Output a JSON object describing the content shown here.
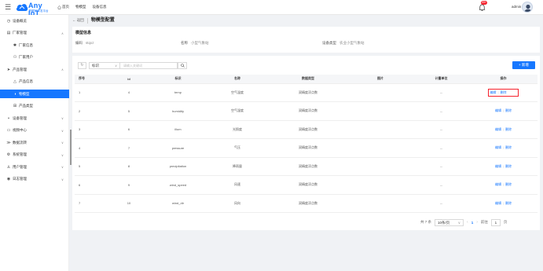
{
  "topbar": {
    "brand": "Any IoT",
    "brand_sub": "物联网开发平台",
    "nav": [
      "首页",
      "物模型",
      "设备信息"
    ],
    "badge": "99+",
    "user": "admin"
  },
  "sidebar": {
    "items": [
      {
        "icon": "dashboard-icon",
        "glyph": "◷",
        "label": "设备概览",
        "arrow": ""
      },
      {
        "icon": "factory-icon",
        "glyph": "▤",
        "label": "厂家管理",
        "arrow": "∧"
      },
      {
        "icon": "gear-icon",
        "glyph": "✱",
        "label": "厂家信息",
        "arrow": "",
        "sub": true
      },
      {
        "icon": "user-icon",
        "glyph": "⚇",
        "label": "厂家用户",
        "arrow": "",
        "sub": true
      },
      {
        "icon": "send-icon",
        "glyph": "➤",
        "label": "产品管理",
        "arrow": "∧"
      },
      {
        "icon": "triangle-icon",
        "glyph": "△",
        "label": "产品信息",
        "arrow": "",
        "sub": true
      },
      {
        "icon": "model-icon",
        "glyph": "◑",
        "label": "物模型",
        "arrow": "",
        "sub": true,
        "active": true
      },
      {
        "icon": "product-type-icon",
        "glyph": "⊞",
        "label": "产品类型",
        "arrow": "",
        "sub": true
      },
      {
        "icon": "device-icon",
        "glyph": "⑂",
        "label": "设备管理",
        "arrow": "∨"
      },
      {
        "icon": "video-icon",
        "glyph": "▭",
        "label": "视频中心",
        "arrow": "∨"
      },
      {
        "icon": "data-icon",
        "glyph": "≫",
        "label": "数据流转",
        "arrow": "∨"
      },
      {
        "icon": "settings-icon",
        "glyph": "⚙",
        "label": "系统管理",
        "arrow": "∨"
      },
      {
        "icon": "users-icon",
        "glyph": "♙",
        "label": "用户管理",
        "arrow": "∨"
      },
      {
        "icon": "log-icon",
        "glyph": "◉",
        "label": "日志管理",
        "arrow": "∨"
      }
    ]
  },
  "breadcrumb": {
    "back": "← 返回",
    "title": "物模型配置"
  },
  "info": {
    "heading": "模型信息",
    "code_label": "编码",
    "code_value": "stqxz",
    "name_label": "名称",
    "name_value": "小型气象站",
    "type_label": "设备类型",
    "type_value": "农业小型气象站"
  },
  "toolbar": {
    "select_value": "标识",
    "search_placeholder": "请输入关键词",
    "add_label": "+ 新增"
  },
  "table": {
    "headers": [
      "序号",
      "id",
      "标识",
      "名称",
      "数据类型",
      "图片",
      "计量单位",
      "操作"
    ],
    "rows": [
      {
        "idx": "1",
        "id": "4",
        "ident": "temp",
        "name": "空气温度",
        "dtype": "双精度浮点数",
        "img": "",
        "unit": "--"
      },
      {
        "idx": "2",
        "id": "5",
        "ident": "humidity",
        "name": "空气湿度",
        "dtype": "双精度浮点数",
        "img": "",
        "unit": "--"
      },
      {
        "idx": "3",
        "id": "6",
        "ident": "illum",
        "name": "光照度",
        "dtype": "双精度浮点数",
        "img": "",
        "unit": "--"
      },
      {
        "idx": "4",
        "id": "7",
        "ident": "pressure",
        "name": "气压",
        "dtype": "双精度浮点数",
        "img": "",
        "unit": "--"
      },
      {
        "idx": "5",
        "id": "8",
        "ident": "precipitation",
        "name": "降雨量",
        "dtype": "双精度浮点数",
        "img": "",
        "unit": "--"
      },
      {
        "idx": "6",
        "id": "9",
        "ident": "wind_speed",
        "name": "风速",
        "dtype": "双精度浮点数",
        "img": "",
        "unit": "--"
      },
      {
        "idx": "7",
        "id": "10",
        "ident": "wind_dir",
        "name": "风向",
        "dtype": "双精度浮点数",
        "img": "",
        "unit": "--"
      }
    ],
    "edit_label": "编辑",
    "delete_label": "删除"
  },
  "pager": {
    "total": "共 7 条",
    "page_size": "10条/页",
    "current": "1",
    "goto_label": "前往",
    "goto_value": "1",
    "page_unit": "页"
  }
}
